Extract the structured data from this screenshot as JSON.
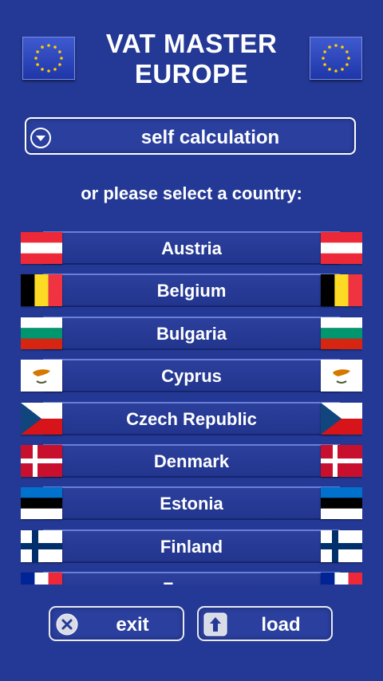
{
  "header": {
    "title_line1": "VAT MASTER",
    "title_line2": "EUROPE"
  },
  "self_calc": {
    "label": "self calculation",
    "icon": "chevron-down-circle-icon"
  },
  "prompt": "or please select a country:",
  "countries": [
    {
      "name": "Austria",
      "flag": "austria"
    },
    {
      "name": "Belgium",
      "flag": "belgium"
    },
    {
      "name": "Bulgaria",
      "flag": "bulgaria"
    },
    {
      "name": "Cyprus",
      "flag": "cyprus"
    },
    {
      "name": "Czech Republic",
      "flag": "czech"
    },
    {
      "name": "Denmark",
      "flag": "denmark"
    },
    {
      "name": "Estonia",
      "flag": "estonia"
    },
    {
      "name": "Finland",
      "flag": "finland"
    },
    {
      "name": "France",
      "flag": "france"
    }
  ],
  "buttons": {
    "exit_label": "exit",
    "load_label": "load"
  },
  "colors": {
    "background": "#243996",
    "eu_blue": "#1e36a8",
    "eu_star": "#ffcc00"
  }
}
